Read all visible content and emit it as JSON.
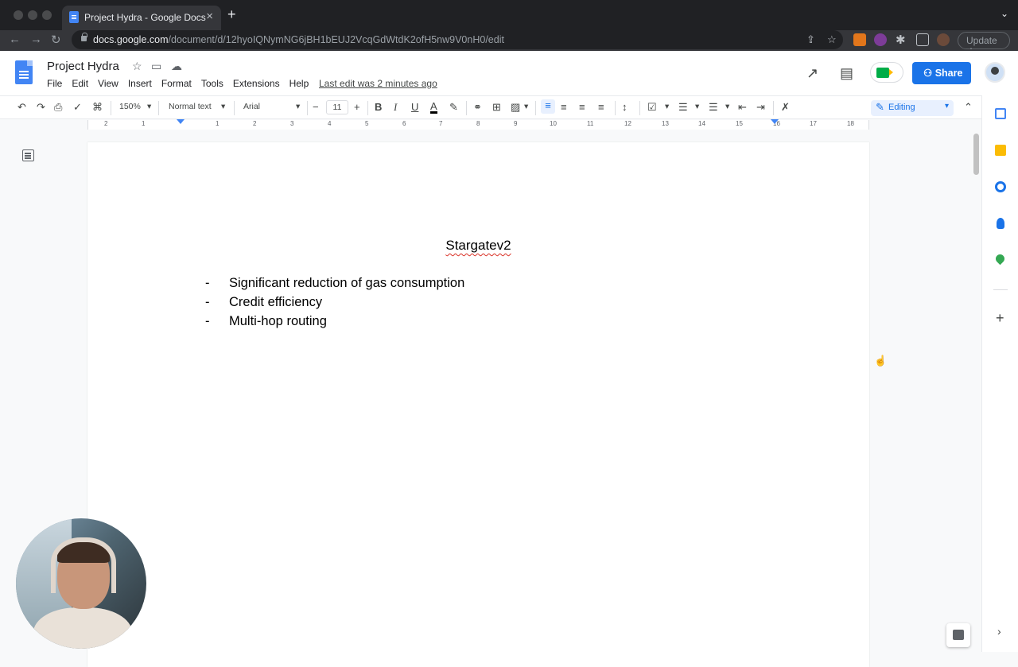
{
  "browser": {
    "tab_title": "Project Hydra - Google Docs",
    "url_host": "docs.google.com",
    "url_path": "/document/d/12hyoIQNymNG6jBH1bEUJ2VcqGdWtdK2ofH5nw9V0nH0/edit",
    "update_label": "Update"
  },
  "docs": {
    "title": "Project Hydra",
    "menu": [
      "File",
      "Edit",
      "View",
      "Insert",
      "Format",
      "Tools",
      "Extensions",
      "Help"
    ],
    "last_edit": "Last edit was 2 minutes ago",
    "share_label": "Share"
  },
  "toolbar": {
    "zoom": "150%",
    "style": "Normal text",
    "font": "Arial",
    "font_size": "11",
    "mode": "Editing"
  },
  "ruler": {
    "numbers": [
      "2",
      "1",
      "1",
      "2",
      "3",
      "4",
      "5",
      "6",
      "7",
      "8",
      "9",
      "10",
      "11",
      "12",
      "13",
      "14",
      "15",
      "16",
      "17",
      "18"
    ]
  },
  "document": {
    "heading": "Stargatev2",
    "bullet_marker": "-",
    "bullets": [
      "Significant reduction of gas consumption",
      "Credit efficiency",
      "Multi-hop routing"
    ]
  },
  "colors": {
    "accent": "#1a73e8",
    "docs_blue": "#4285f4"
  }
}
